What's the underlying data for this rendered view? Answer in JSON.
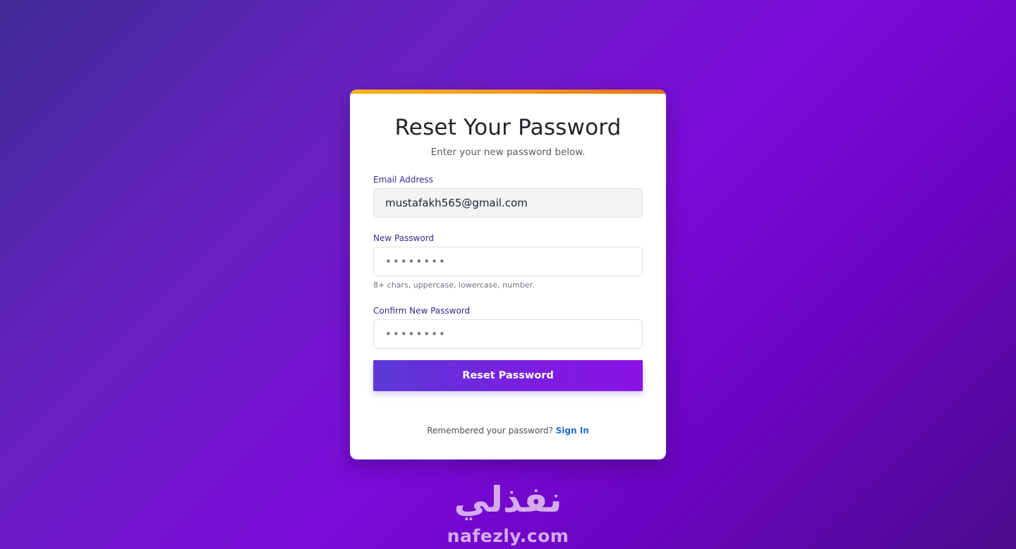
{
  "form": {
    "title": "Reset Your Password",
    "subtitle": "Enter your new password below.",
    "email_label": "Email Address",
    "email_value": "mustafakh565@gmail.com",
    "new_password_label": "New Password",
    "new_password_value": "••••••••",
    "new_password_hint": "8+ chars, uppercase, lowercase, number.",
    "confirm_password_label": "Confirm New Password",
    "confirm_password_value": "••••••••",
    "submit_label": "Reset Password",
    "footer_text": "Remembered your password?",
    "footer_link": "Sign In"
  },
  "brand": {
    "logo_arabic": "نفذلي",
    "logo_latin": "nafezly.com"
  },
  "colors": {
    "accent_bar": "#f29a1c",
    "button_start": "#5b3ad6",
    "button_end": "#8b12e6",
    "link": "#1d6fd8",
    "label": "#3a2a8c"
  }
}
